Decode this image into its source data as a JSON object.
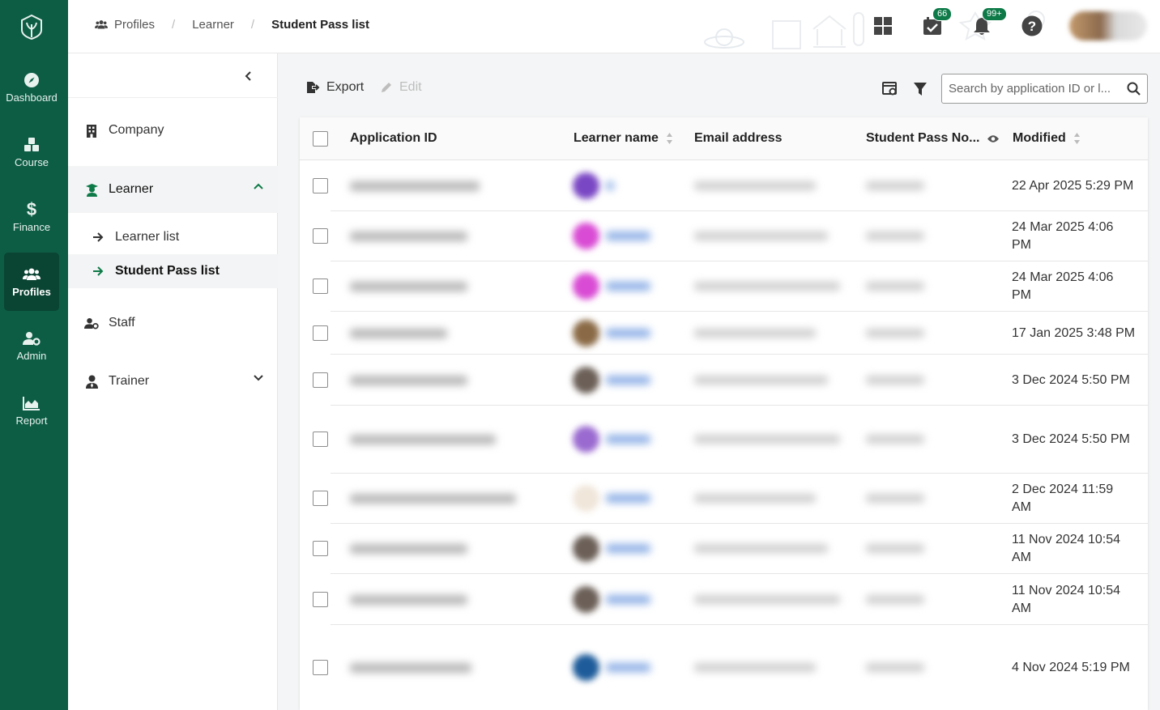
{
  "nav_rail": {
    "items": [
      {
        "label": "Dashboard",
        "icon": "compass-icon"
      },
      {
        "label": "Course",
        "icon": "cubes-icon"
      },
      {
        "label": "Finance",
        "icon": "dollar-icon"
      },
      {
        "label": "Profiles",
        "icon": "users-icon",
        "active": true
      },
      {
        "label": "Admin",
        "icon": "user-gear-icon"
      },
      {
        "label": "Report",
        "icon": "area-chart-icon"
      }
    ]
  },
  "header": {
    "breadcrumb": [
      "Profiles",
      "Learner",
      "Student Pass list"
    ],
    "badges": {
      "tasks": "66",
      "notifications": "99+"
    }
  },
  "sidebar": {
    "items": [
      {
        "label": "Company"
      },
      {
        "label": "Learner",
        "expanded": true,
        "children": [
          {
            "label": "Learner list"
          },
          {
            "label": "Student Pass list",
            "active": true
          }
        ]
      },
      {
        "label": "Staff"
      },
      {
        "label": "Trainer"
      }
    ]
  },
  "toolbar": {
    "export_label": "Export",
    "edit_label": "Edit",
    "search_placeholder": "Search by application ID or l..."
  },
  "table": {
    "columns": [
      "Application ID",
      "Learner name",
      "Email address",
      "Student Pass No...",
      "Modified"
    ],
    "rows": [
      {
        "modified": [
          "22 Apr 2025 5:29 PM"
        ],
        "avatar_color": "#7a47c4"
      },
      {
        "modified": [
          "24 Mar 2025 4:06",
          "PM"
        ],
        "avatar_color": "#d94bd4"
      },
      {
        "modified": [
          "24 Mar 2025 4:06",
          "PM"
        ],
        "avatar_color": "#d94bd4"
      },
      {
        "modified": [
          "17 Jan 2025 3:48 PM"
        ],
        "avatar_color": "#8a6a46"
      },
      {
        "modified": [
          "3 Dec 2024 5:50 PM"
        ],
        "avatar_color": "#6b5f57"
      },
      {
        "modified": [
          "3 Dec 2024 5:50 PM"
        ],
        "avatar_color": "#9a6ad0"
      },
      {
        "modified": [
          "2 Dec 2024 11:59",
          "AM"
        ],
        "avatar_color": "#f0e6da"
      },
      {
        "modified": [
          "11 Nov 2024 10:54",
          "AM"
        ],
        "avatar_color": "#6b5f57"
      },
      {
        "modified": [
          "11 Nov 2024 10:54",
          "AM"
        ],
        "avatar_color": "#6b5f57"
      },
      {
        "modified": [
          "4 Nov 2024 5:19 PM"
        ],
        "avatar_color": "#1d5b9a"
      }
    ]
  },
  "colors": {
    "brand": "#0d5d45",
    "brand_active": "#0a4433",
    "badge": "#0d7a48"
  }
}
